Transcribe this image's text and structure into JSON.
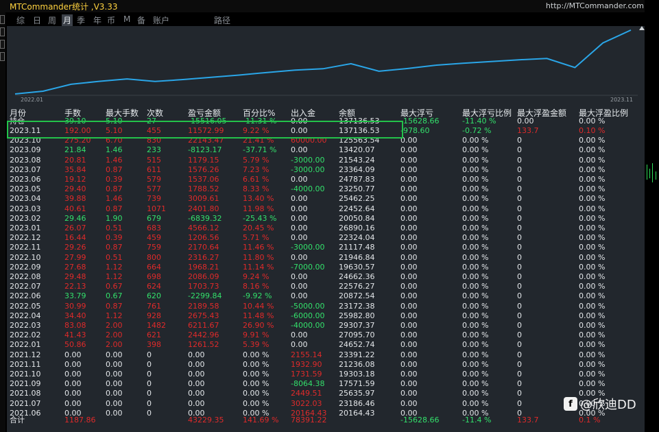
{
  "app": {
    "title": "MTCommander统计 ,V3.33",
    "url": "http://MTCommander.com"
  },
  "tabs": [
    {
      "label": "综",
      "active": false
    },
    {
      "label": "日",
      "active": false
    },
    {
      "label": "周",
      "active": false
    },
    {
      "label": "月",
      "active": true
    },
    {
      "label": "季",
      "active": false
    },
    {
      "label": "年",
      "active": false
    },
    {
      "label": "币",
      "active": false
    },
    {
      "label": "M",
      "active": false
    },
    {
      "label": "备",
      "active": false
    },
    {
      "label": "账户",
      "active": false
    },
    {
      "label": "路径",
      "active": false
    }
  ],
  "chart_data": {
    "type": "line",
    "x_start_label": "2022.01",
    "x_end_label": "2023.11",
    "color": "#2aa6e8",
    "ylim": [
      0,
      160000
    ]
  },
  "headers": [
    "月份",
    "手数",
    "最大手数",
    "次数",
    "盈亏金额",
    "百分比%",
    "出入金",
    "余额",
    "最大浮亏",
    "最大浮亏比例",
    "最大浮盈金额",
    "最大浮盈比例"
  ],
  "holding": {
    "c": [
      "持仓",
      "39.10",
      "5.10",
      "27",
      "-15516.05",
      "-11.31 %",
      "0.00",
      "137136.53",
      "-15628.66",
      "-11.40 %",
      "0.00",
      "0.00 %"
    ],
    "k": [
      "w",
      "g",
      "g",
      "g",
      "g",
      "g",
      "w",
      "w",
      "g",
      "g",
      "w",
      "w"
    ]
  },
  "rows": [
    {
      "c": [
        "2023.11",
        "192.00",
        "5.10",
        "455",
        "11572.99",
        "9.22 %",
        "0.00",
        "137136.53",
        "-978.60",
        "-0.72 %",
        "133.7",
        "0.10 %"
      ],
      "k": [
        "w",
        "r",
        "r",
        "r",
        "r",
        "r",
        "w",
        "w",
        "g",
        "g",
        "r",
        "r"
      ]
    },
    {
      "c": [
        "2023.10",
        "275.20",
        "6.70",
        "830",
        "22143.47",
        "21.41 %",
        "60000.00",
        "125563.54",
        "0.00",
        "0.00 %",
        "0",
        "0.00 %"
      ],
      "k": [
        "w",
        "r",
        "r",
        "r",
        "r",
        "r",
        "r",
        "w",
        "w",
        "w",
        "w",
        "w"
      ]
    },
    {
      "c": [
        "2023.09",
        "21.84",
        "1.46",
        "233",
        "-8123.17",
        "-37.71 %",
        "0.00",
        "13420.07",
        "0.00",
        "0.00 %",
        "0",
        "0.00 %"
      ],
      "k": [
        "w",
        "g",
        "g",
        "g",
        "g",
        "g",
        "w",
        "w",
        "w",
        "w",
        "w",
        "w"
      ]
    },
    {
      "c": [
        "2023.08",
        "20.81",
        "1.46",
        "515",
        "1179.15",
        "5.79 %",
        "-3000.00",
        "21543.24",
        "0.00",
        "0.00 %",
        "0",
        "0.00 %"
      ],
      "k": [
        "w",
        "r",
        "r",
        "r",
        "r",
        "r",
        "g",
        "w",
        "w",
        "w",
        "w",
        "w"
      ]
    },
    {
      "c": [
        "2023.07",
        "35.84",
        "0.87",
        "611",
        "1576.26",
        "7.23 %",
        "-3000.00",
        "23364.09",
        "0.00",
        "0.00 %",
        "0",
        "0.00 %"
      ],
      "k": [
        "w",
        "r",
        "r",
        "r",
        "r",
        "r",
        "g",
        "w",
        "w",
        "w",
        "w",
        "w"
      ]
    },
    {
      "c": [
        "2023.06",
        "19.12",
        "0.39",
        "579",
        "1537.06",
        "6.61 %",
        "0.00",
        "24787.83",
        "0.00",
        "0.00 %",
        "0",
        "0.00 %"
      ],
      "k": [
        "w",
        "r",
        "r",
        "r",
        "r",
        "r",
        "w",
        "w",
        "w",
        "w",
        "w",
        "w"
      ]
    },
    {
      "c": [
        "2023.05",
        "29.40",
        "0.87",
        "577",
        "1788.52",
        "8.33 %",
        "-4000.00",
        "23250.77",
        "0.00",
        "0.00 %",
        "0",
        "0.00 %"
      ],
      "k": [
        "w",
        "r",
        "r",
        "r",
        "r",
        "r",
        "g",
        "w",
        "w",
        "w",
        "w",
        "w"
      ]
    },
    {
      "c": [
        "2023.04",
        "39.88",
        "1.46",
        "739",
        "3009.61",
        "13.40 %",
        "0.00",
        "25462.25",
        "0.00",
        "0.00 %",
        "0",
        "0.00 %"
      ],
      "k": [
        "w",
        "r",
        "r",
        "r",
        "r",
        "r",
        "w",
        "w",
        "w",
        "w",
        "w",
        "w"
      ]
    },
    {
      "c": [
        "2023.03",
        "40.61",
        "0.87",
        "1071",
        "2401.80",
        "11.98 %",
        "0.00",
        "22452.64",
        "0.00",
        "0.00 %",
        "0",
        "0.00 %"
      ],
      "k": [
        "w",
        "r",
        "r",
        "r",
        "r",
        "r",
        "w",
        "w",
        "w",
        "w",
        "w",
        "w"
      ]
    },
    {
      "c": [
        "2023.02",
        "29.46",
        "1.90",
        "679",
        "-6839.32",
        "-25.43 %",
        "0.00",
        "20050.84",
        "0.00",
        "0.00 %",
        "0",
        "0.00 %"
      ],
      "k": [
        "w",
        "g",
        "g",
        "g",
        "g",
        "g",
        "w",
        "w",
        "w",
        "w",
        "w",
        "w"
      ]
    },
    {
      "c": [
        "2023.01",
        "26.07",
        "0.51",
        "683",
        "4566.12",
        "20.45 %",
        "0.00",
        "26890.16",
        "0.00",
        "0.00 %",
        "0",
        "0.00 %"
      ],
      "k": [
        "w",
        "r",
        "r",
        "r",
        "r",
        "r",
        "w",
        "w",
        "w",
        "w",
        "w",
        "w"
      ]
    },
    {
      "c": [
        "2022.12",
        "16.44",
        "0.39",
        "459",
        "1206.56",
        "5.71 %",
        "0.00",
        "22324.04",
        "0.00",
        "0.00 %",
        "0",
        "0.00 %"
      ],
      "k": [
        "w",
        "r",
        "r",
        "r",
        "r",
        "r",
        "w",
        "w",
        "w",
        "w",
        "w",
        "w"
      ]
    },
    {
      "c": [
        "2022.11",
        "29.26",
        "0.87",
        "759",
        "2170.64",
        "11.46 %",
        "-3000.00",
        "21117.48",
        "0.00",
        "0.00 %",
        "0",
        "0.00 %"
      ],
      "k": [
        "w",
        "r",
        "r",
        "r",
        "r",
        "r",
        "g",
        "w",
        "w",
        "w",
        "w",
        "w"
      ]
    },
    {
      "c": [
        "2022.10",
        "27.99",
        "0.51",
        "800",
        "2316.27",
        "11.80 %",
        "0.00",
        "21946.84",
        "0.00",
        "0.00 %",
        "0",
        "0.00 %"
      ],
      "k": [
        "w",
        "r",
        "r",
        "r",
        "r",
        "r",
        "w",
        "w",
        "w",
        "w",
        "w",
        "w"
      ]
    },
    {
      "c": [
        "2022.09",
        "27.68",
        "1.12",
        "664",
        "1968.21",
        "11.14 %",
        "-7000.00",
        "19630.57",
        "0.00",
        "0.00 %",
        "0",
        "0.00 %"
      ],
      "k": [
        "w",
        "r",
        "r",
        "r",
        "r",
        "r",
        "g",
        "w",
        "w",
        "w",
        "w",
        "w"
      ]
    },
    {
      "c": [
        "2022.08",
        "29.48",
        "1.12",
        "698",
        "2086.09",
        "9.24 %",
        "0.00",
        "24662.36",
        "0.00",
        "0.00 %",
        "0",
        "0.00 %"
      ],
      "k": [
        "w",
        "r",
        "r",
        "r",
        "r",
        "r",
        "w",
        "w",
        "w",
        "w",
        "w",
        "w"
      ]
    },
    {
      "c": [
        "2022.07",
        "22.13",
        "0.67",
        "624",
        "1703.73",
        "8.16 %",
        "0.00",
        "22576.27",
        "0.00",
        "0.00 %",
        "0",
        "0.00 %"
      ],
      "k": [
        "w",
        "r",
        "r",
        "r",
        "r",
        "r",
        "w",
        "w",
        "w",
        "w",
        "w",
        "w"
      ]
    },
    {
      "c": [
        "2022.06",
        "33.79",
        "0.67",
        "620",
        "-2299.84",
        "-9.92 %",
        "0.00",
        "20872.54",
        "0.00",
        "0.00 %",
        "0",
        "0.00 %"
      ],
      "k": [
        "w",
        "g",
        "g",
        "g",
        "g",
        "g",
        "w",
        "w",
        "w",
        "w",
        "w",
        "w"
      ]
    },
    {
      "c": [
        "2022.05",
        "30.99",
        "0.87",
        "761",
        "2189.58",
        "10.44 %",
        "-5000.00",
        "23172.38",
        "0.00",
        "0.00 %",
        "0",
        "0.00 %"
      ],
      "k": [
        "w",
        "r",
        "r",
        "r",
        "r",
        "r",
        "g",
        "w",
        "w",
        "w",
        "w",
        "w"
      ]
    },
    {
      "c": [
        "2022.04",
        "34.40",
        "1.12",
        "928",
        "2675.43",
        "11.48 %",
        "-6000.00",
        "25982.80",
        "0.00",
        "0.00 %",
        "0",
        "0.00 %"
      ],
      "k": [
        "w",
        "r",
        "r",
        "r",
        "r",
        "r",
        "g",
        "w",
        "w",
        "w",
        "w",
        "w"
      ]
    },
    {
      "c": [
        "2022.03",
        "83.08",
        "2.00",
        "1482",
        "6211.67",
        "26.90 %",
        "-4000.00",
        "29307.37",
        "0.00",
        "0.00 %",
        "0",
        "0.00 %"
      ],
      "k": [
        "w",
        "r",
        "r",
        "r",
        "r",
        "r",
        "g",
        "w",
        "w",
        "w",
        "w",
        "w"
      ]
    },
    {
      "c": [
        "2022.02",
        "41.43",
        "2.00",
        "621",
        "2442.96",
        "9.91 %",
        "0.00",
        "27095.70",
        "0.00",
        "0.00 %",
        "0",
        "0.00 %"
      ],
      "k": [
        "w",
        "r",
        "r",
        "r",
        "r",
        "r",
        "w",
        "w",
        "w",
        "w",
        "w",
        "w"
      ]
    },
    {
      "c": [
        "2022.01",
        "50.86",
        "2.00",
        "398",
        "1261.52",
        "5.39 %",
        "0.00",
        "24652.74",
        "0.00",
        "0.00 %",
        "0",
        "0.00 %"
      ],
      "k": [
        "w",
        "r",
        "r",
        "r",
        "r",
        "r",
        "w",
        "w",
        "w",
        "w",
        "w",
        "w"
      ]
    },
    {
      "c": [
        "2021.12",
        "0.00",
        "0.00",
        "0",
        "0.00",
        "0.00 %",
        "2155.14",
        "23391.22",
        "0.00",
        "0.00 %",
        "0",
        "0.00 %"
      ],
      "k": [
        "w",
        "w",
        "w",
        "w",
        "w",
        "w",
        "r",
        "w",
        "w",
        "w",
        "w",
        "w"
      ]
    },
    {
      "c": [
        "2021.11",
        "0.00",
        "0.00",
        "0",
        "0.00",
        "0.00 %",
        "1932.90",
        "21236.08",
        "0.00",
        "0.00 %",
        "0",
        "0.00 %"
      ],
      "k": [
        "w",
        "w",
        "w",
        "w",
        "w",
        "w",
        "r",
        "w",
        "w",
        "w",
        "w",
        "w"
      ]
    },
    {
      "c": [
        "2021.10",
        "0.00",
        "0.00",
        "0",
        "0.00",
        "0.00 %",
        "1731.59",
        "19303.18",
        "0.00",
        "0.00 %",
        "0",
        "0.00 %"
      ],
      "k": [
        "w",
        "w",
        "w",
        "w",
        "w",
        "w",
        "r",
        "w",
        "w",
        "w",
        "w",
        "w"
      ]
    },
    {
      "c": [
        "2021.09",
        "0.00",
        "0.00",
        "0",
        "0.00",
        "0.00 %",
        "-8064.38",
        "17571.59",
        "0.00",
        "0.00 %",
        "0",
        "0.00 %"
      ],
      "k": [
        "w",
        "w",
        "w",
        "w",
        "w",
        "w",
        "g",
        "w",
        "w",
        "w",
        "w",
        "w"
      ]
    },
    {
      "c": [
        "2021.08",
        "0.00",
        "0.00",
        "0",
        "0.00",
        "0.00 %",
        "2449.51",
        "25635.97",
        "0.00",
        "0.00 %",
        "0",
        "0.00 %"
      ],
      "k": [
        "w",
        "w",
        "w",
        "w",
        "w",
        "w",
        "r",
        "w",
        "w",
        "w",
        "w",
        "w"
      ]
    },
    {
      "c": [
        "2021.07",
        "0.00",
        "0.00",
        "0",
        "0.00",
        "0.00 %",
        "3022.03",
        "23186.46",
        "0.00",
        "0.00 %",
        "0",
        "0.00 %"
      ],
      "k": [
        "w",
        "w",
        "w",
        "w",
        "w",
        "w",
        "r",
        "w",
        "w",
        "w",
        "w",
        "w"
      ]
    },
    {
      "c": [
        "2021.06",
        "0.00",
        "0.00",
        "0",
        "0.00",
        "0.00 %",
        "20164.43",
        "20164.43",
        "0.00",
        "0.00 %",
        "0",
        "0.00 %"
      ],
      "k": [
        "w",
        "w",
        "w",
        "w",
        "w",
        "w",
        "r",
        "w",
        "w",
        "w",
        "w",
        "w"
      ]
    }
  ],
  "total": {
    "c": [
      "合计",
      "1187.86",
      "",
      "",
      "43229.35",
      "141.69 %",
      "78391.22",
      "",
      "-15628.66",
      "-11.4 %",
      "133.7",
      "0.1 %"
    ],
    "k": [
      "w",
      "r",
      "w",
      "w",
      "r",
      "r",
      "r",
      "w",
      "g",
      "g",
      "r",
      "r"
    ]
  },
  "watermark": {
    "logo": "f",
    "text": "@欣迪DD"
  },
  "colors": {
    "profit": "#e02a2a",
    "loss": "#33e06b",
    "highlight": "#23c24a"
  }
}
